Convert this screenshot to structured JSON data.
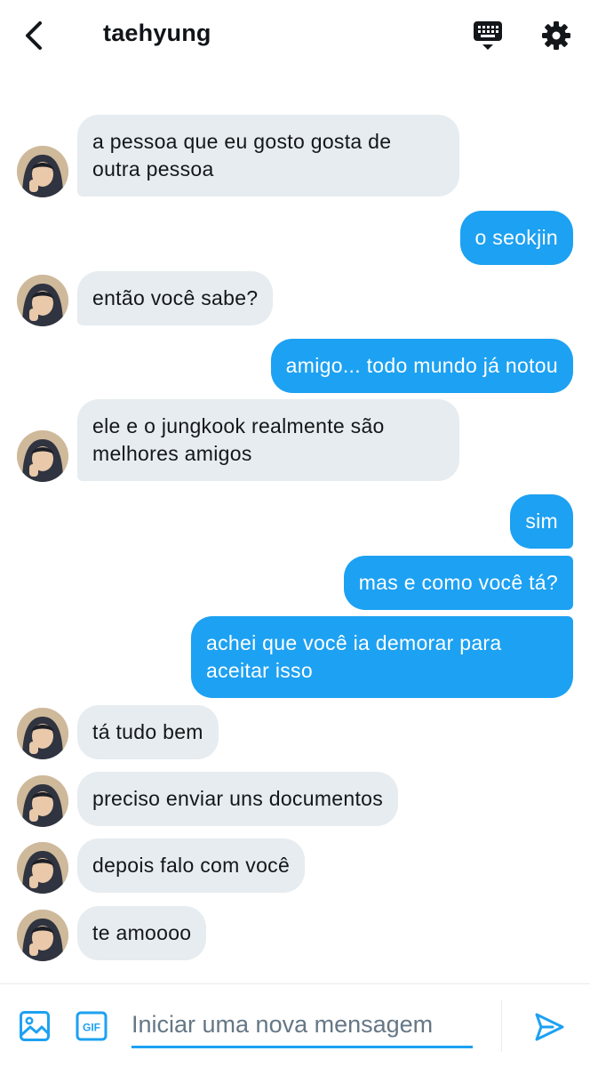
{
  "header": {
    "title": "taehyung",
    "icons": {
      "back": "chevron-left-icon",
      "keyboard": "keyboard-icon",
      "settings": "gear-icon"
    }
  },
  "messages": [
    {
      "from": "them",
      "text": "a pessoa que eu gosto gosta de\noutra pessoa"
    },
    {
      "from": "me",
      "text": "o seokjin"
    },
    {
      "from": "them",
      "text": "então você sabe?"
    },
    {
      "from": "me",
      "text": "amigo... todo mundo já notou"
    },
    {
      "from": "them",
      "text": "ele e o jungkook realmente são\nmelhores amigos"
    },
    {
      "from": "me",
      "text": "sim"
    },
    {
      "from": "me",
      "text": "mas e como você tá?"
    },
    {
      "from": "me",
      "text": "achei que você ia demorar para\naceitar isso"
    },
    {
      "from": "them",
      "text": "tá tudo bem"
    },
    {
      "from": "them",
      "text": "preciso enviar uns documentos"
    },
    {
      "from": "them",
      "text": "depois falo com você"
    },
    {
      "from": "them",
      "text": "te amoooo"
    }
  ],
  "composer": {
    "placeholder": "Iniciar uma nova mensagem",
    "gif_label": "GIF",
    "icons": {
      "media": "image-icon",
      "gif": "gif-icon",
      "send": "send-icon"
    }
  },
  "colors": {
    "accent": "#1da1f2",
    "received_bubble": "#e6ecf0",
    "text": "#14171a",
    "placeholder": "#657786"
  }
}
